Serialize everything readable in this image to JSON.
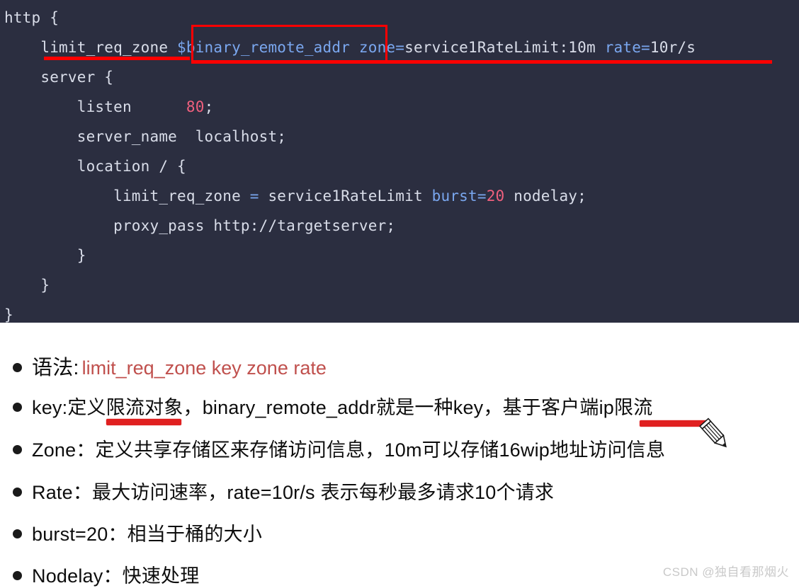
{
  "code": {
    "language": "nginx",
    "background": "#2b2e40",
    "lines": [
      {
        "indent": 0,
        "tokens": [
          {
            "t": "http {",
            "c": "plain"
          }
        ]
      },
      {
        "indent": 4,
        "tokens": [
          {
            "t": "limit_req_zone ",
            "c": "plain"
          },
          {
            "t": "$binary_remote_addr",
            "c": "var"
          },
          {
            "t": " ",
            "c": "plain"
          },
          {
            "t": "zone=",
            "c": "key"
          },
          {
            "t": "service1RateLimit:10m ",
            "c": "plain"
          },
          {
            "t": "rate=",
            "c": "key"
          },
          {
            "t": "10r/s",
            "c": "plain"
          }
        ]
      },
      {
        "indent": 4,
        "tokens": [
          {
            "t": "server {",
            "c": "plain"
          }
        ]
      },
      {
        "indent": 8,
        "tokens": [
          {
            "t": "listen      ",
            "c": "plain"
          },
          {
            "t": "80",
            "c": "num"
          },
          {
            "t": ";",
            "c": "plain"
          }
        ]
      },
      {
        "indent": 8,
        "tokens": [
          {
            "t": "server_name  localhost;",
            "c": "plain"
          }
        ]
      },
      {
        "indent": 8,
        "tokens": [
          {
            "t": "location / {",
            "c": "plain"
          }
        ]
      },
      {
        "indent": 12,
        "tokens": [
          {
            "t": "limit_req_zone ",
            "c": "plain"
          },
          {
            "t": "=",
            "c": "key"
          },
          {
            "t": " service1RateLimit ",
            "c": "plain"
          },
          {
            "t": "burst=",
            "c": "key"
          },
          {
            "t": "20",
            "c": "num"
          },
          {
            "t": " nodelay;",
            "c": "plain"
          }
        ]
      },
      {
        "indent": 12,
        "tokens": [
          {
            "t": "proxy_pass http://targetserver;",
            "c": "plain"
          }
        ]
      },
      {
        "indent": 8,
        "tokens": [
          {
            "t": "}",
            "c": "plain"
          }
        ]
      },
      {
        "indent": 4,
        "tokens": [
          {
            "t": "}",
            "c": "plain"
          }
        ]
      },
      {
        "indent": 0,
        "tokens": [
          {
            "t": "}",
            "c": "plain"
          }
        ]
      }
    ],
    "annotations": {
      "highlight_box_target": "$binary_remote_addr",
      "underline_short_target": "limit_req_zone",
      "underline_long_target": "limit_req_zone $binary_remote_addr zone=service1RateLimit:10m rate=10r/s",
      "color": "#ff0000"
    }
  },
  "notes": {
    "bullets": [
      {
        "id": "syntax",
        "label": "语法:",
        "code": "limit_req_zone key zone rate",
        "code_color": "#c0504d"
      },
      {
        "id": "key",
        "label": "key:定义限流对象，binary_remote_addr就是一种key，基于客户端ip限流"
      },
      {
        "id": "zone",
        "label": "Zone：定义共享存储区来存储访问信息，10m可以存储16wip地址访问信息"
      },
      {
        "id": "rate",
        "label": "Rate：最大访问速率，rate=10r/s  表示每秒最多请求10个请求"
      },
      {
        "id": "burst",
        "label": "burst=20：相当于桶的大小"
      },
      {
        "id": "nodelay",
        "label": "Nodelay：快速处理"
      }
    ],
    "marker_color": "#e02020"
  },
  "watermark": {
    "text": "CSDN @独自看那烟火"
  }
}
